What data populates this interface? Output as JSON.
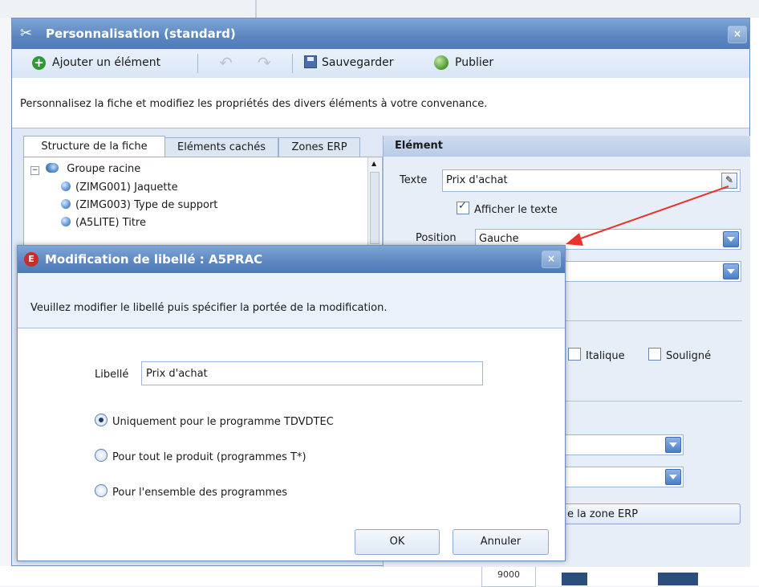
{
  "main_window": {
    "title": "Personnalisation (standard)",
    "close_label": "×",
    "toolbar": {
      "add_label": "Ajouter un élément",
      "save_label": "Sauvegarder",
      "publish_label": "Publier"
    },
    "info_text": "Personnalisez la fiche et modifiez les propriétés des divers éléments à votre convenance.",
    "tabs": [
      "Structure de la fiche",
      "Eléments cachés",
      "Zones ERP"
    ],
    "tree": {
      "root": "Groupe racine",
      "items": [
        "(ZIMG001) Jaquette",
        "(ZIMG003) Type de support",
        "(A5LITE) Titre"
      ]
    },
    "element_panel": {
      "header": "Elément",
      "texte_label": "Texte",
      "texte_value": "Prix d'achat",
      "afficher_label": "Afficher le texte",
      "position_label": "Position",
      "position_value": "Gauche",
      "italique_label": "Italique",
      "souligne_label": "Souligné",
      "erp_button_partial": "e la zone ERP"
    },
    "bg_value": "9000"
  },
  "dialog": {
    "title": "Modification de libellé : A5PRAC",
    "close_label": "×",
    "instruction": "Veuillez modifier le libellé puis spécifier la portée de la modification.",
    "libelle_label": "Libellé",
    "libelle_value": "Prix d'achat",
    "options": [
      "Uniquement pour le programme TDVDTEC",
      "Pour tout le produit (programmes T*)",
      "Pour l'ensemble des programmes"
    ],
    "selected_option": 0,
    "ok_label": "OK",
    "cancel_label": "Annuler"
  },
  "colors": {
    "accent": "#5b86c0",
    "arrow": "#e8332a",
    "dialog_badge": "#c4302b"
  }
}
